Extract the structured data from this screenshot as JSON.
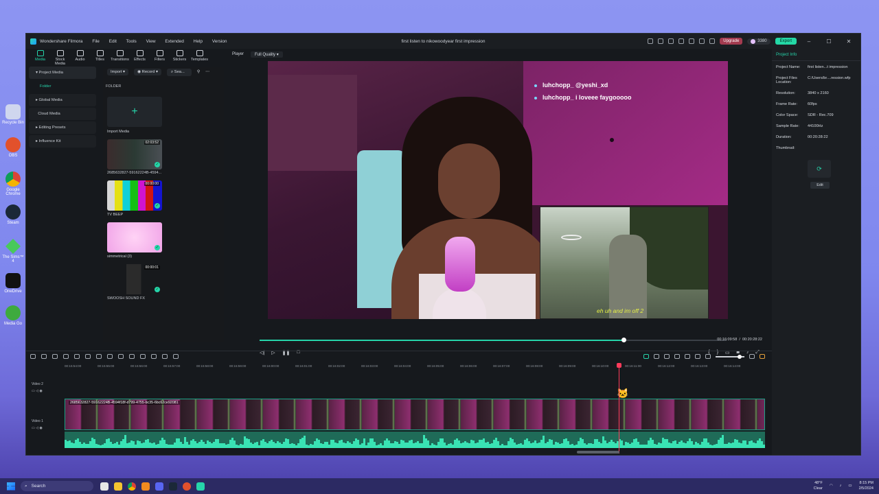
{
  "desktop": {
    "icons": [
      "Recycle Bin",
      "OBS",
      "Google Chrome",
      "Steam",
      "The Sims™ 4",
      "OneDrive",
      "Media Go"
    ]
  },
  "window": {
    "app_name": "Wondershare Filmora",
    "menu": [
      "File",
      "Edit",
      "Tools",
      "View",
      "Extended",
      "Help",
      "Version"
    ],
    "doc_title": "first listen to nikowoodyear first impression",
    "upgrade": "Upgrade",
    "credits": "3380",
    "export": "Export"
  },
  "toolbar": {
    "items": [
      "Media",
      "Stock Media",
      "Audio",
      "Titles",
      "Transitions",
      "Effects",
      "Filters",
      "Stickers",
      "Templates"
    ]
  },
  "left_panel": {
    "project_media": "Project Media",
    "folder": "Folder",
    "global_media": "Global Media",
    "cloud_media": "Cloud Media",
    "editing_presets": "Editing Presets",
    "influence_kit": "Influence Kit"
  },
  "media": {
    "import": "Import",
    "record": "Record",
    "search_placeholder": "Sea...",
    "folder_label": "FOLDER",
    "import_media": "Import Media",
    "items": [
      {
        "name": "2685632827-59162224B-4594...",
        "duration": "02:03:52"
      },
      {
        "name": "TV BEEP",
        "duration": "00:00:00"
      },
      {
        "name": "simmetrical (3)",
        "duration": ""
      },
      {
        "name": "SWOOSH SOUND FX",
        "duration": "00:00:01"
      }
    ]
  },
  "player": {
    "label": "Player",
    "quality": "Full Quality",
    "chat": [
      "luhchopp_ @yeshi_xd",
      "luhchopp_ i loveee faygooooo"
    ],
    "subtitle": "eh uh and im off 2",
    "current_time": "00:16:09:58",
    "total_time": "00:20:28:22",
    "progress": 0.78
  },
  "project_info": {
    "tab": "Project Info",
    "rows": [
      {
        "k": "Project Name:",
        "v": "first listen...t impression"
      },
      {
        "k": "Project Files Location:",
        "v": "C:/Users/br....ression.wfp"
      },
      {
        "k": "Resolution:",
        "v": "3840 x 2160"
      },
      {
        "k": "Frame Rate:",
        "v": "60fps"
      },
      {
        "k": "Color Space:",
        "v": "SDR - Rec.709"
      },
      {
        "k": "Sample Rate:",
        "v": "44100Hz"
      },
      {
        "k": "Duration:",
        "v": "00:20:28:22"
      },
      {
        "k": "Thumbnail:",
        "v": ""
      }
    ],
    "edit": "Edit"
  },
  "timeline": {
    "ruler": [
      "00:15:54:00",
      "00:15:55:00",
      "00:15:56:00",
      "00:15:57:00",
      "00:15:58:00",
      "00:15:59:00",
      "00:16:00:00",
      "00:16:01:00",
      "00:16:02:00",
      "00:16:03:00",
      "00:16:04:00",
      "00:16:05:00",
      "00:16:06:00",
      "00:16:07:00",
      "00:16:08:00",
      "00:16:09:00",
      "00:16:10:00",
      "00:16:11:00",
      "00:16:12:00",
      "00:16:13:00",
      "00:16:14:00"
    ],
    "video2": "Video 2",
    "video1": "Video 1",
    "clip_title": "2685632827-59162224B-4594f18f-d799-4755-bc35-6bc62ce92081"
  },
  "taskbar": {
    "search": "Search",
    "weather_temp": "48°F",
    "weather_desc": "Clear",
    "time": "8:15 PM",
    "date": "2/5/2024"
  }
}
